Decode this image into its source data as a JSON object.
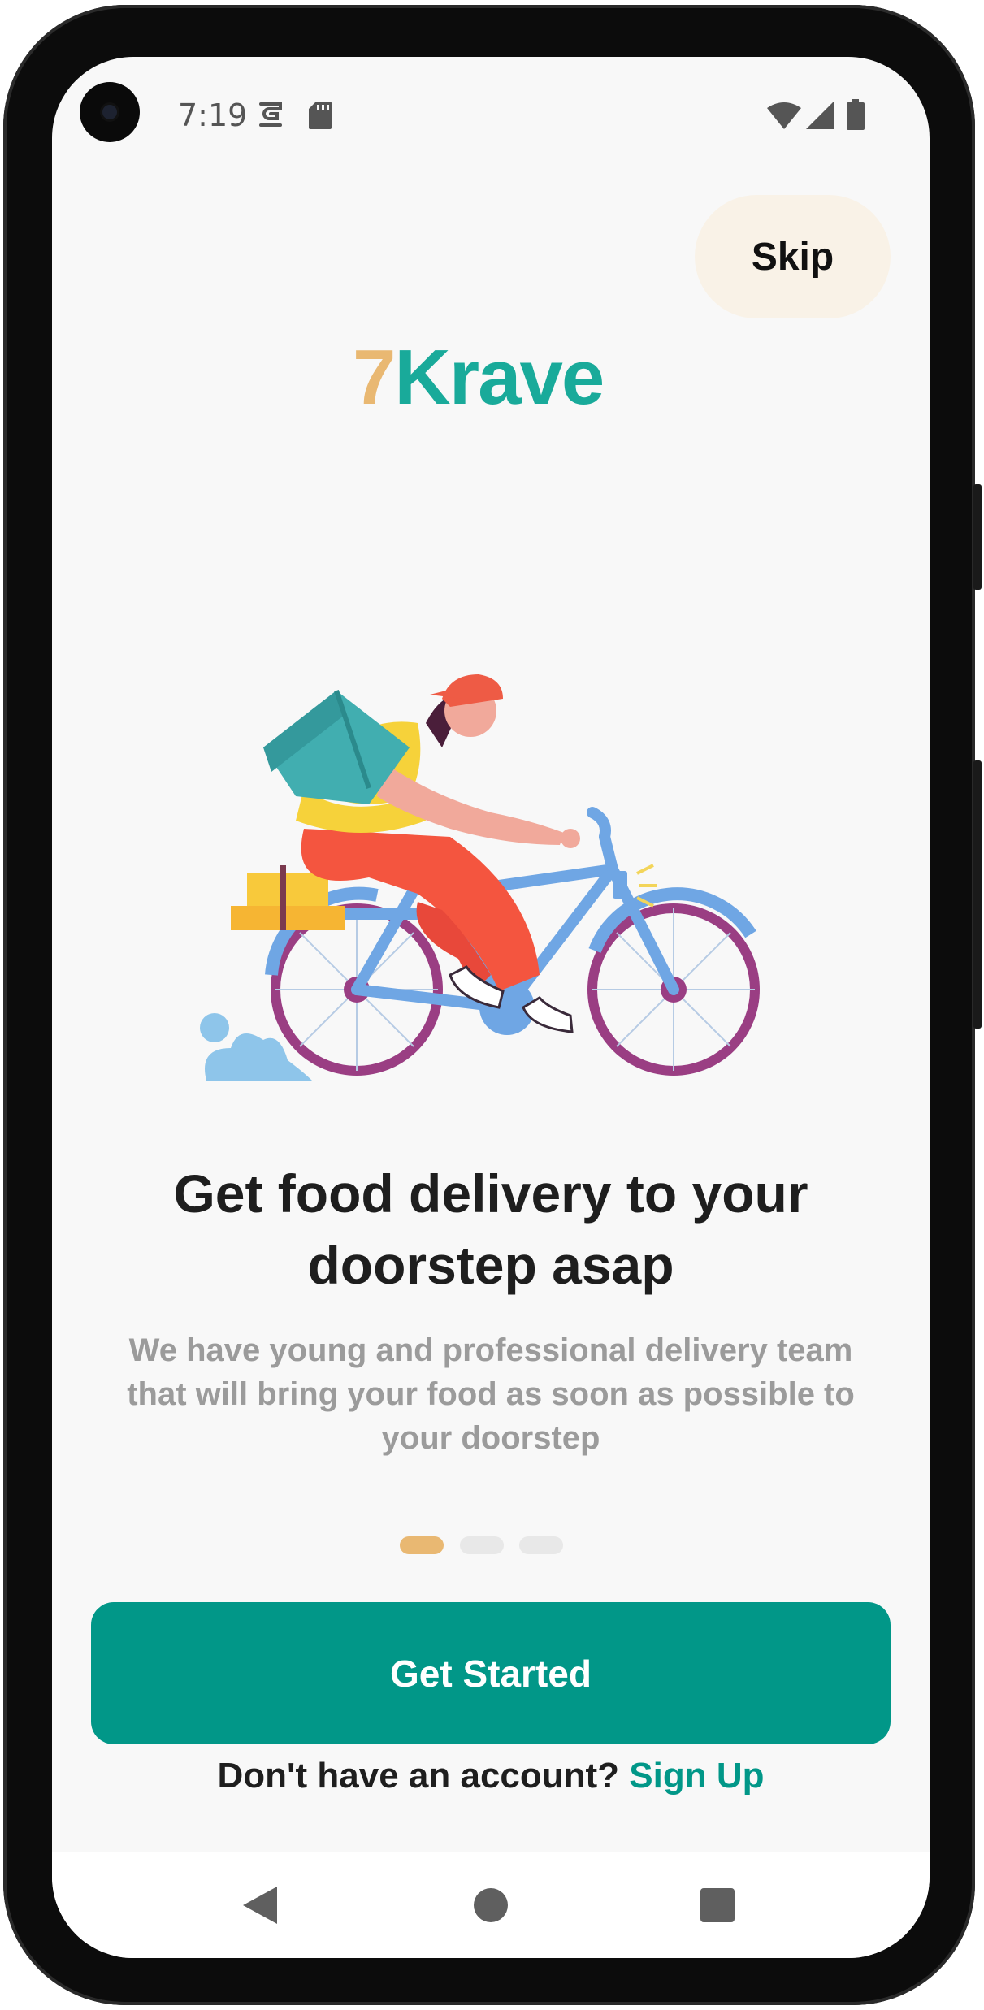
{
  "status_bar": {
    "time": "7:19",
    "icons": [
      "notification-icon",
      "sd-card-icon",
      "wifi-icon",
      "signal-icon",
      "battery-icon"
    ]
  },
  "header": {
    "skip_label": "Skip"
  },
  "brand": {
    "logo_prefix": "7",
    "logo_name": "Krave"
  },
  "onboarding": {
    "headline_line1": "Get food delivery to your",
    "headline_line2": "doorstep asap",
    "description_line1": "We have young and professional delivery team",
    "description_line2": "that will bring your food as soon as possible to",
    "description_line3": "your doorstep",
    "page_count": 3,
    "current_page": 1
  },
  "actions": {
    "get_started_label": "Get Started",
    "signup_prompt": "Don't have an account?",
    "signup_link_label": "Sign Up"
  },
  "nav_bar": {
    "buttons": [
      "back-icon",
      "home-icon",
      "recents-icon"
    ]
  },
  "colors": {
    "primary": "#019788",
    "accent": "#e9b872",
    "logo_teal": "#19aa9a",
    "skip_bg": "#f9f2e7",
    "screen_bg": "#f8f8f8"
  }
}
